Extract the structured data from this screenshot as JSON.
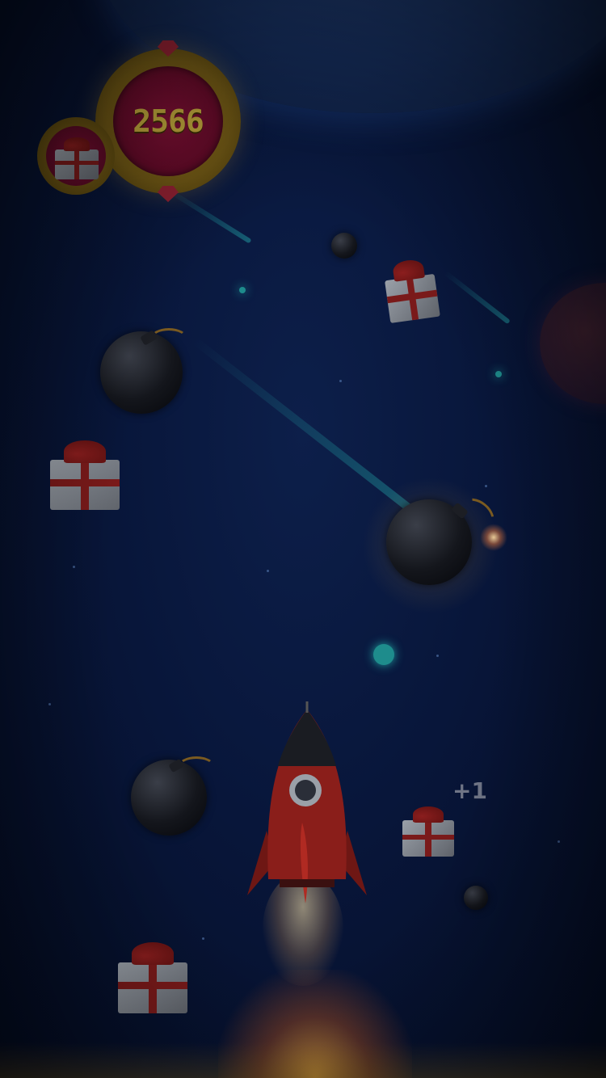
{
  "hud": {
    "score": "2566",
    "gift_badge_icon": "gift-icon",
    "score_gem_icon": "ruby-gem-icon"
  },
  "popup": {
    "bonus_text": "+1"
  },
  "sprites": {
    "player": "rocket-icon",
    "collectible": "gift-icon",
    "hazard": "bomb-icon"
  },
  "colors": {
    "background": "#08163a",
    "score_text": "#b9a13a",
    "badge_gold": "#8a6a1a",
    "badge_red": "#7a0f33",
    "rocket_red": "#8a1e1a",
    "ribbon_red": "#7a1a1a"
  }
}
